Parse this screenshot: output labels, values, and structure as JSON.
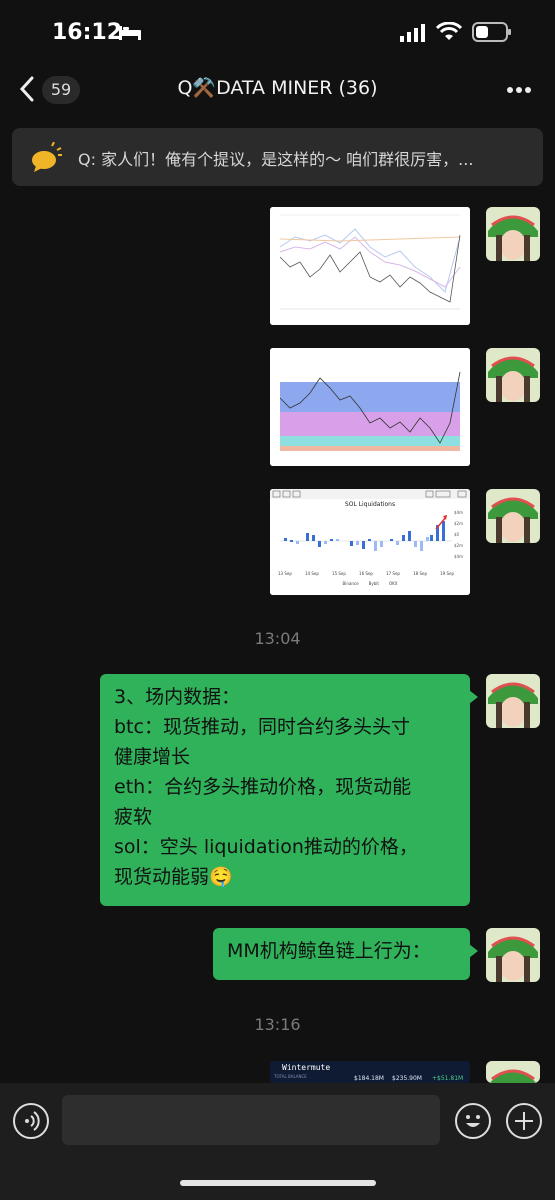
{
  "status": {
    "time": "16:12"
  },
  "header": {
    "back_count": "59",
    "title": "Q⚒️DATA MINER (36)"
  },
  "pinned": {
    "text": "Q: 家人们！俺有个提议，是这样的～ 咱们群很厉害，..."
  },
  "chart_images": {
    "sol_title": "SOL Liquidations",
    "sol_xticks": [
      "13 Sep",
      "14 Sep",
      "15 Sep",
      "16 Sep",
      "17 Sep",
      "18 Sep",
      "19 Sep"
    ],
    "sol_legend": [
      "Binance",
      "Bybit",
      "OKX"
    ],
    "sol_yticks": [
      "$4m",
      "$2m",
      "$0",
      "$2m",
      "$4m"
    ]
  },
  "messages": [
    {
      "timestamp": "13:04"
    },
    {
      "lines": [
        "3、场内数据：",
        "btc：现货推动，同时合约多头头寸",
        "健康增长",
        "eth：合约多头推动价格，现货动能",
        "疲软",
        "sol：空头 liquidation推动的价格，",
        "现货动能弱🤤"
      ]
    },
    {
      "text": "MM机构鲸鱼链上行为："
    },
    {
      "timestamp": "13:16"
    }
  ],
  "wintermute": {
    "name": "Wintermute",
    "label": "TOTAL BALANCE",
    "v1": "$184.18M",
    "v2": "$235.90M",
    "v3": "+$51.81M"
  },
  "colors": {
    "bubble": "#2fb25a",
    "background": "#111111"
  }
}
